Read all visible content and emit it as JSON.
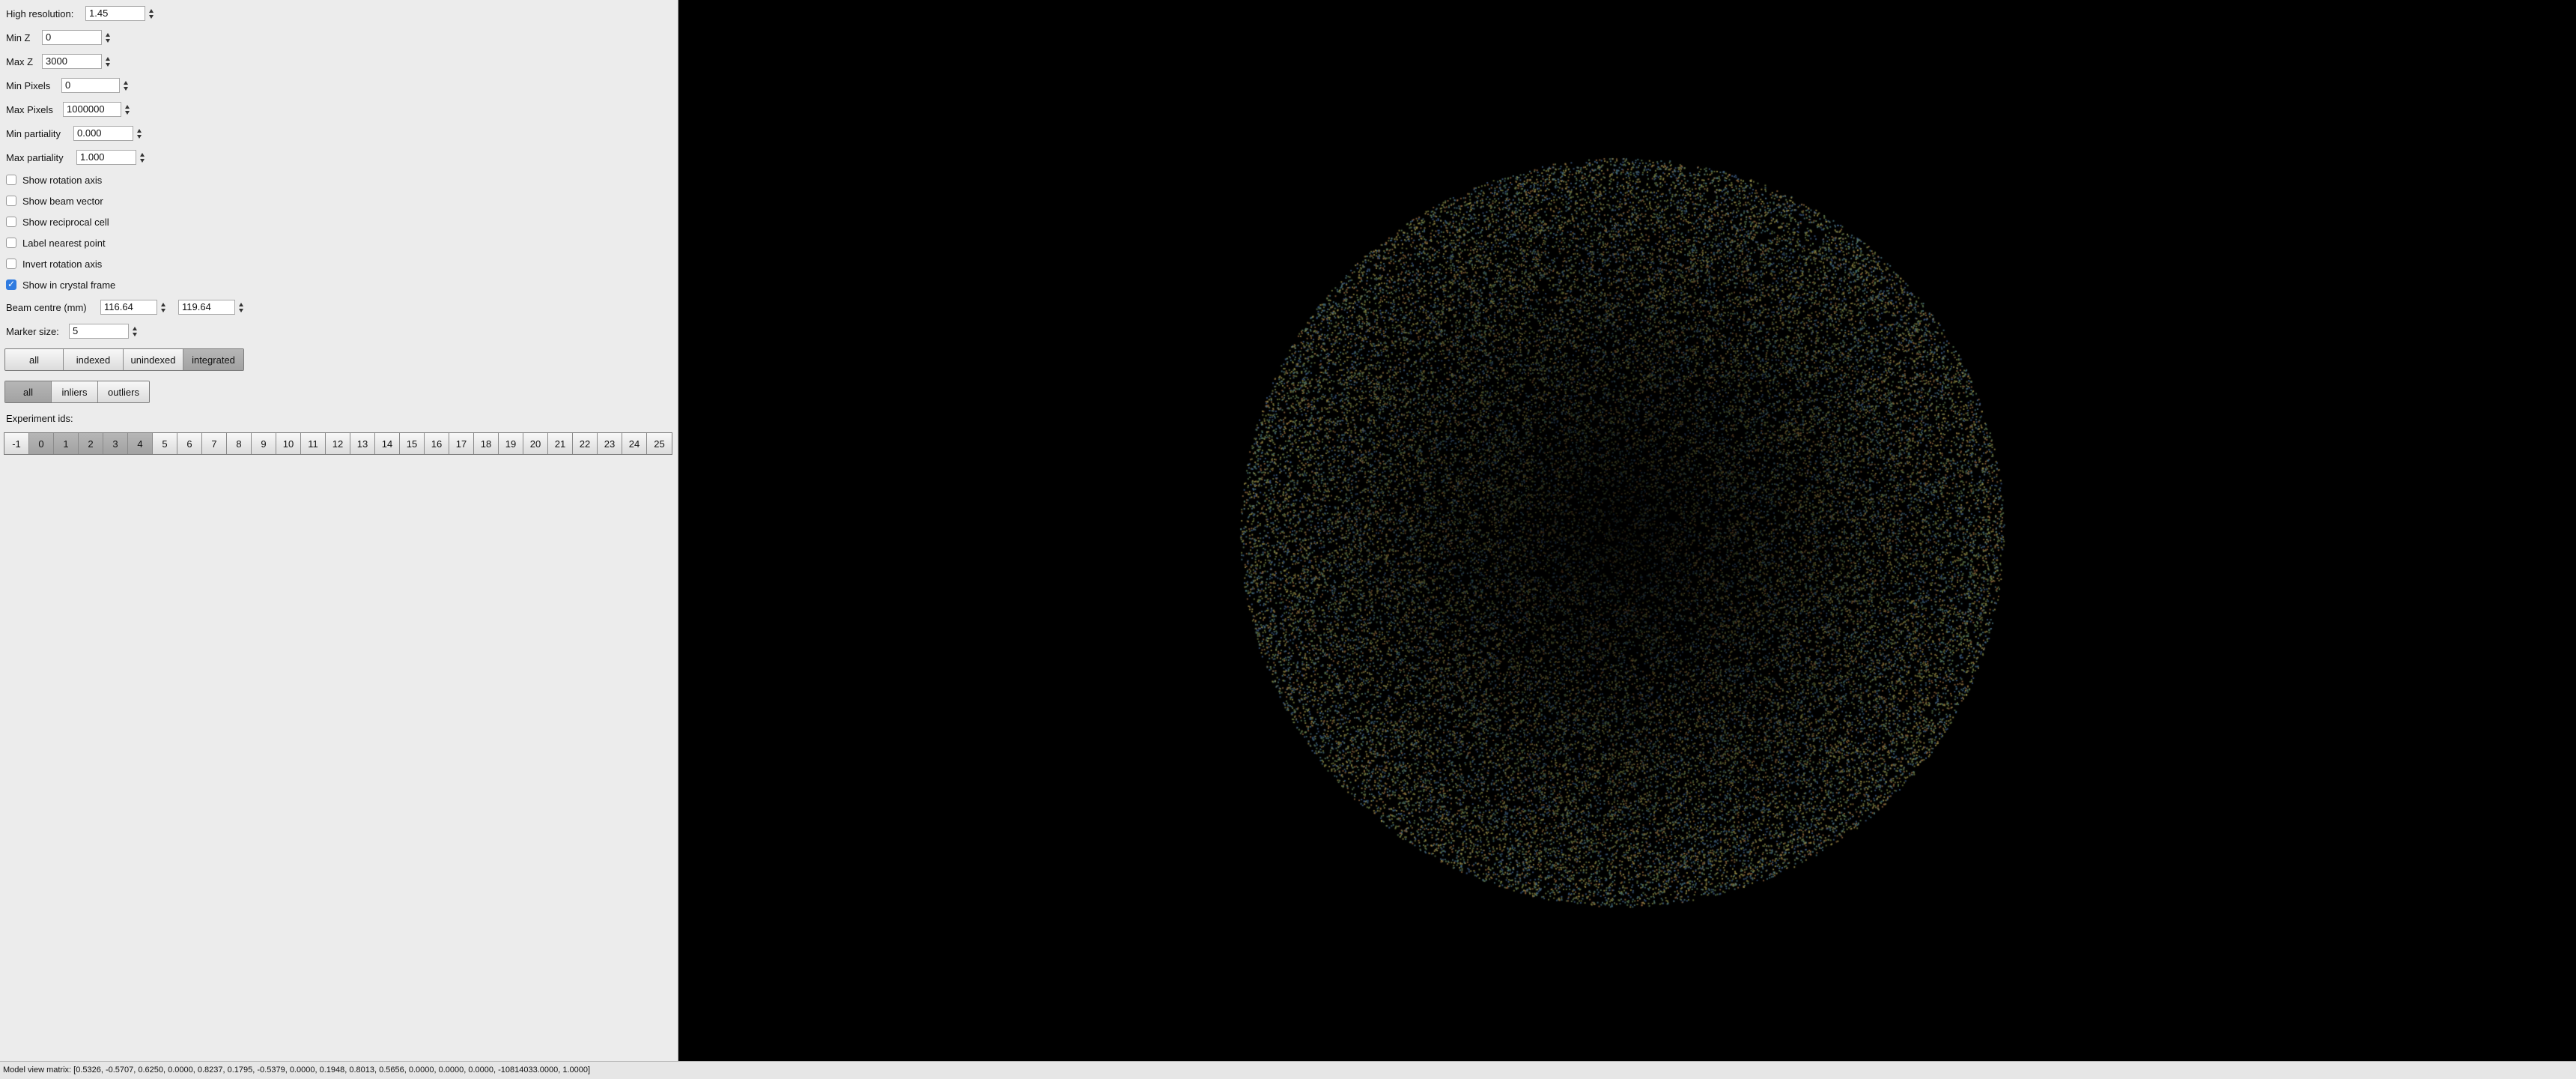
{
  "controls": {
    "high_resolution": {
      "label": "High resolution:",
      "value": "1.45"
    },
    "min_z": {
      "label": "Min Z",
      "value": "0"
    },
    "max_z": {
      "label": "Max Z",
      "value": "3000"
    },
    "min_pixels": {
      "label": "Min Pixels",
      "value": "0"
    },
    "max_pixels": {
      "label": "Max Pixels",
      "value": "1000000"
    },
    "min_partiality": {
      "label": "Min partiality",
      "value": "0.000"
    },
    "max_partiality": {
      "label": "Max partiality",
      "value": "1.000"
    }
  },
  "checkboxes": [
    {
      "label": "Show rotation axis",
      "checked": false
    },
    {
      "label": "Show beam vector",
      "checked": false
    },
    {
      "label": "Show reciprocal cell",
      "checked": false
    },
    {
      "label": "Label nearest point",
      "checked": false
    },
    {
      "label": "Invert rotation axis",
      "checked": false
    },
    {
      "label": "Show in crystal frame",
      "checked": true
    }
  ],
  "beam_centre": {
    "label": "Beam centre (mm)",
    "x": "116.64",
    "y": "119.64"
  },
  "marker_size": {
    "label": "Marker size:",
    "value": "5"
  },
  "filter_group_1": {
    "buttons": [
      "all",
      "indexed",
      "unindexed",
      "integrated"
    ],
    "selected": "integrated"
  },
  "filter_group_2": {
    "buttons": [
      "all",
      "inliers",
      "outliers"
    ],
    "selected": "all"
  },
  "experiment_ids": {
    "label": "Experiment ids:",
    "ids": [
      "-1",
      "0",
      "1",
      "2",
      "3",
      "4",
      "5",
      "6",
      "7",
      "8",
      "9",
      "10",
      "11",
      "12",
      "13",
      "14",
      "15",
      "16",
      "17",
      "18",
      "19",
      "20",
      "21",
      "22",
      "23",
      "24",
      "25"
    ],
    "selected": [
      "0",
      "1",
      "2",
      "3",
      "4"
    ]
  },
  "status": {
    "text": "Model view matrix: [0.5326, -0.5707, 0.6250, 0.0000, 0.8237, 0.1795, -0.5379, 0.0000, 0.1948, 0.8013, 0.5656, 0.0000, 0.0000, 0.0000, -10814033.0000, 1.0000]"
  },
  "colors": {
    "panel_bg": "#ececec",
    "viewport_bg": "#000000",
    "checkbox_checked": "#2f7be0",
    "segment_selected": "#a8a8a8"
  }
}
